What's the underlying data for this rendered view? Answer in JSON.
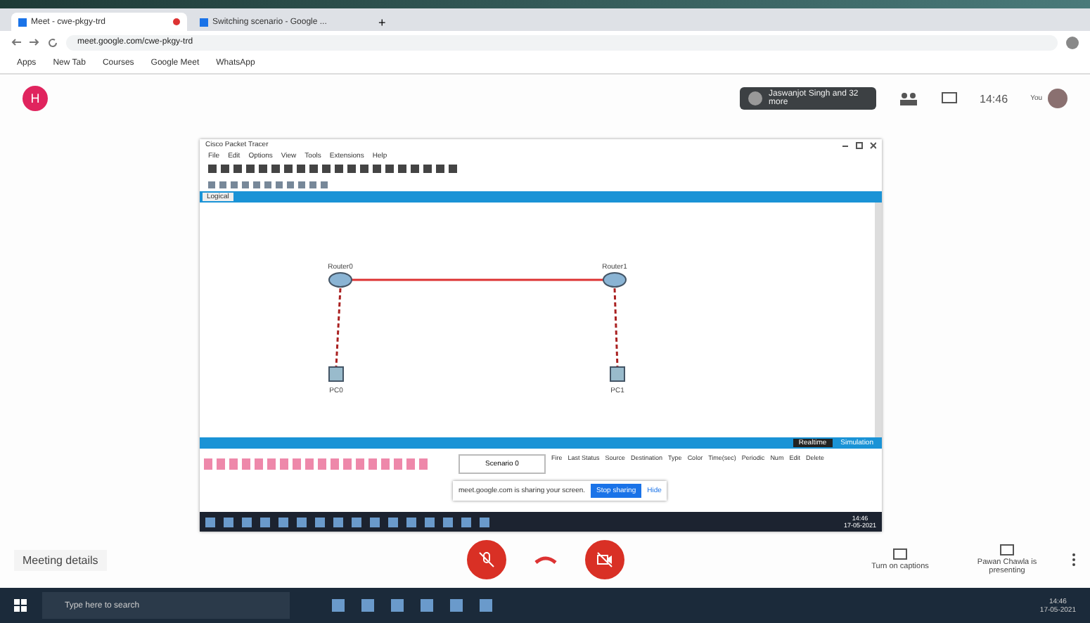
{
  "browser": {
    "tabs": [
      {
        "title": "Meet - cwe-pkgy-trd",
        "selected": true,
        "recording": true
      },
      {
        "title": "Switching scenario - Google ...",
        "selected": false,
        "recording": false
      }
    ],
    "new_tab": "+",
    "address": "meet.google.com/cwe-pkgy-trd",
    "bookmarks": [
      "Apps",
      "New Tab",
      "Courses",
      "Google Meet",
      "WhatsApp"
    ]
  },
  "meet": {
    "self_initial": "H",
    "participants_chip": "Jaswanjot Singh and 32 more",
    "clock": "14:46",
    "self_label": "You",
    "shared_screen": {
      "app_title": "Cisco Packet Tracer",
      "menu": [
        "File",
        "Edit",
        "Options",
        "View",
        "Tools",
        "Extensions",
        "Help"
      ],
      "workspace_tab": "Logical",
      "nodes": [
        {
          "kind": "router",
          "label": "Router0"
        },
        {
          "kind": "router",
          "label": "Router1"
        },
        {
          "kind": "pc",
          "label": "PC0"
        },
        {
          "kind": "pc",
          "label": "PC1"
        }
      ],
      "modes": [
        {
          "label": "Realtime",
          "selected": true
        },
        {
          "label": "Simulation",
          "selected": false
        }
      ],
      "scenario": "Scenario 0",
      "pdu_columns": [
        "Fire",
        "Last Status",
        "Source",
        "Destination",
        "Type",
        "Color",
        "Time(sec)",
        "Periodic",
        "Num",
        "Edit",
        "Delete"
      ],
      "sharing_banner": {
        "text": "meet.google.com is sharing your screen.",
        "stop": "Stop sharing",
        "hide": "Hide"
      },
      "taskbar_time": "14:46",
      "taskbar_date": "17-05-2021"
    },
    "meeting_details": "Meeting details",
    "mic_muted": true,
    "camera_off": true,
    "captions": "Turn on captions",
    "presenter": "Pawan Chawla is presenting"
  },
  "taskbar": {
    "search_placeholder": "Type here to search",
    "time": "14:46",
    "date": "17-05-2021"
  }
}
